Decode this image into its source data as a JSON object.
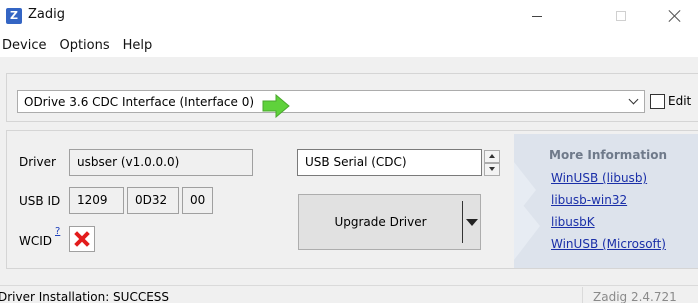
{
  "window": {
    "app_icon_letter": "Z",
    "title": "Zadig"
  },
  "menu": {
    "items": [
      "Device",
      "Options",
      "Help"
    ]
  },
  "device": {
    "selected": "ODrive 3.6 CDC Interface (Interface 0)",
    "edit_label": "Edit",
    "edit_checked": false
  },
  "driver": {
    "label": "Driver",
    "current": "usbser (v1.0.0.0)",
    "target": "USB Serial (CDC)"
  },
  "usb_id": {
    "label": "USB ID",
    "vid": "1209",
    "pid": "0D32",
    "mi": "00"
  },
  "wcid": {
    "label": "WCID",
    "help": "?",
    "status_icon": "red-x-icon"
  },
  "action": {
    "button_label": "Upgrade Driver"
  },
  "more_info": {
    "title": "More Information",
    "links": [
      "WinUSB (libusb)",
      "libusb-win32",
      "libusbK",
      "WinUSB (Microsoft)"
    ]
  },
  "status": {
    "message": "Driver Installation: SUCCESS",
    "version": "Zadig 2.4.721"
  },
  "colors": {
    "arrow_green": "#5fd23b",
    "link_blue": "#1a2fa8",
    "wcid_red": "#e31c1c",
    "info_bg": "#dde3ec"
  }
}
